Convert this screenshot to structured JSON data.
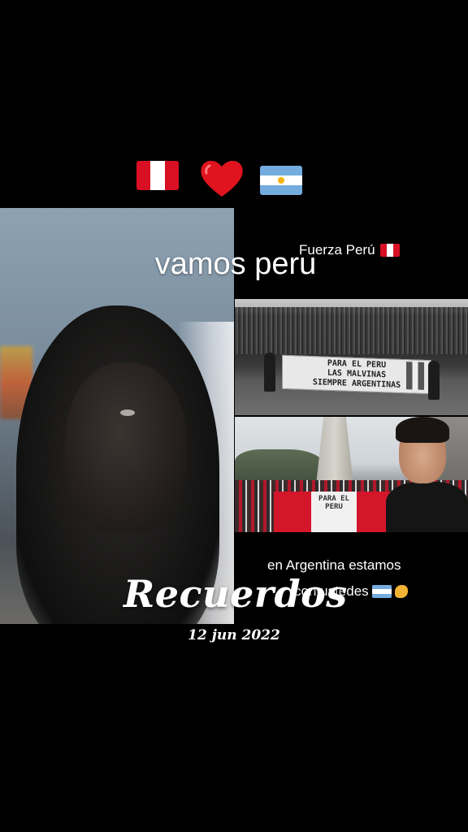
{
  "overlay": {
    "headline": "vamos peru",
    "caption_top_right": "Fuerza Perú",
    "caption_bottom_line1": "en Argentina estamos",
    "caption_bottom_line2": "con ustedes",
    "title": "Recuerdos",
    "date": "12 jun 2022"
  },
  "stadium_photo": {
    "banner_line1": "PARA EL PERU",
    "banner_line2": "LAS MALVINAS",
    "banner_line3": "SIEMPRE ARGENTINAS"
  },
  "city_photo": {
    "banner_text": "PARA EL PERU"
  },
  "icons": {
    "top_row": [
      "peru-flag-icon",
      "red-heart-icon",
      "argentina-flag-icon"
    ],
    "fuerza": "peru-flag-icon",
    "ustedes": [
      "argentina-flag-icon",
      "flexed-biceps-icon"
    ]
  },
  "colors": {
    "background": "#000000",
    "peru_red": "#d91023",
    "argentina_blue": "#74acdf",
    "heart_red": "#e0141e",
    "text": "#ffffff"
  }
}
